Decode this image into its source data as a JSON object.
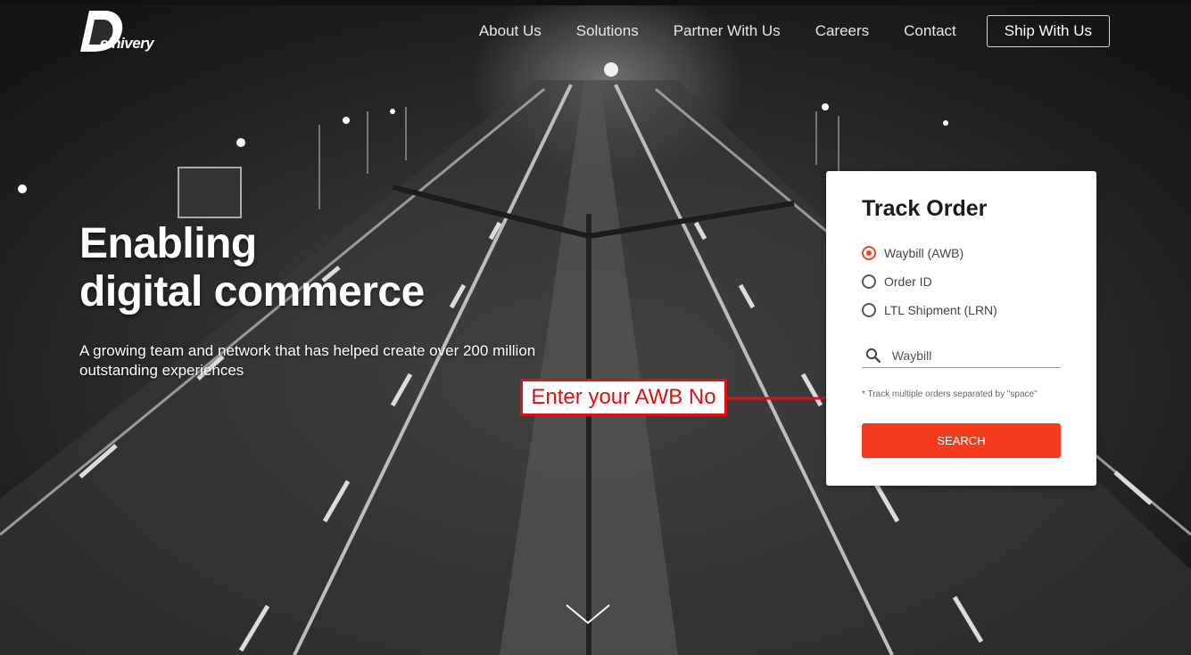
{
  "brand": {
    "logo_text": "elhivery",
    "colors": {
      "accent": "#f53b1e",
      "annotation": "#dd1111"
    }
  },
  "nav": {
    "items": [
      "About Us",
      "Solutions",
      "Partner With Us",
      "Careers",
      "Contact"
    ],
    "cta": "Ship With Us"
  },
  "hero": {
    "headline_line1": "Enabling",
    "headline_line2": "digital commerce",
    "tagline": "A growing team and network that has helped create over 200 million outstanding experiences"
  },
  "track": {
    "title": "Track Order",
    "options": [
      {
        "label": "Waybill (AWB)",
        "selected": true
      },
      {
        "label": "Order ID",
        "selected": false
      },
      {
        "label": "LTL Shipment (LRN)",
        "selected": false
      }
    ],
    "search_placeholder": "Waybill",
    "hint": "* Track multiple orders separated by \"space\"",
    "button": "SEARCH",
    "icons": {
      "search": "search-icon"
    }
  },
  "annotation": {
    "text": "Enter your AWB No"
  },
  "scroll": {
    "icon": "chevron-down-icon"
  }
}
